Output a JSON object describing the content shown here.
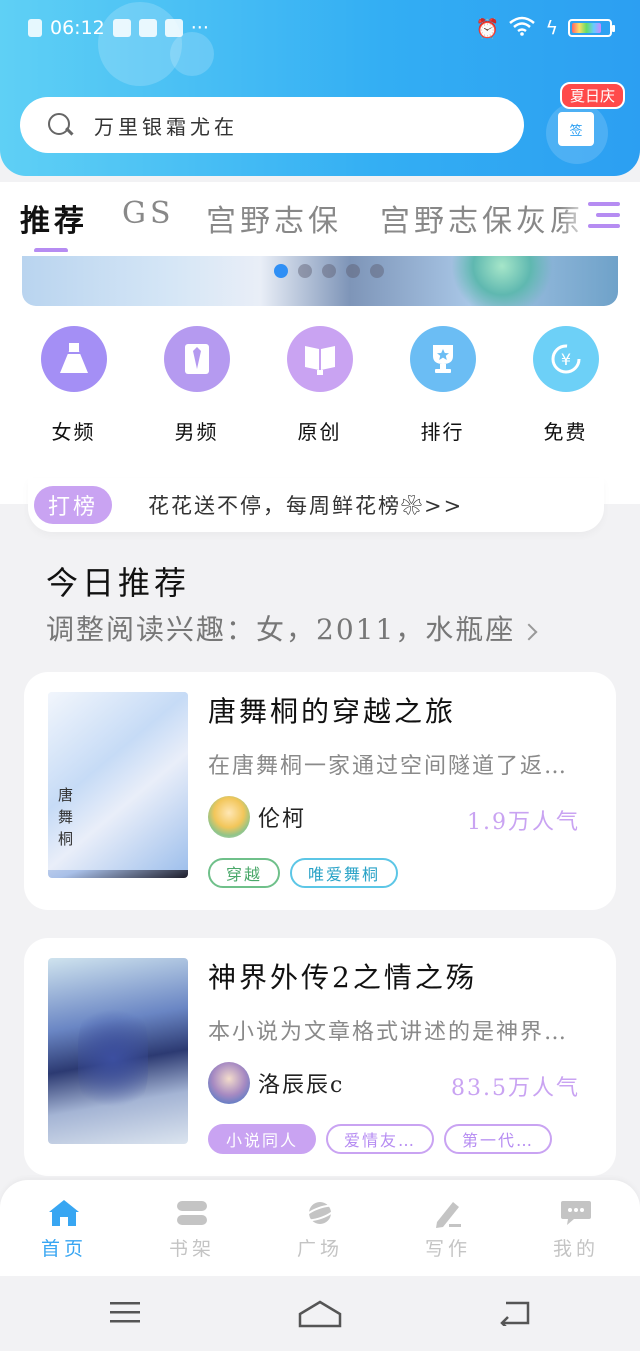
{
  "status_bar": {
    "time": "06:12",
    "colors": {
      "battery": "#ffffff"
    }
  },
  "search": {
    "placeholder": "万里银霜尤在"
  },
  "checkin": {
    "badge": "夏日庆",
    "label": "签"
  },
  "tabs": [
    {
      "label": "推荐",
      "active": true
    },
    {
      "label": "GS"
    },
    {
      "label": "宫野志保"
    },
    {
      "label": "宫野志保灰原"
    }
  ],
  "banner": {
    "active_index": 0
  },
  "categories": [
    {
      "label": "女频",
      "icon": "dress-icon"
    },
    {
      "label": "男频",
      "icon": "shirt-tie-icon"
    },
    {
      "label": "原创",
      "icon": "book-icon"
    },
    {
      "label": "排行",
      "icon": "trophy-icon"
    },
    {
      "label": "免费",
      "icon": "yen-icon"
    }
  ],
  "notice": {
    "tag": "打榜",
    "message": "花花送不停，每周鲜花榜❀>>"
  },
  "section": {
    "title": "今日推荐",
    "subtitle": "调整阅读兴趣：女，2011，水瓶座"
  },
  "books": [
    {
      "title": "唐舞桐的穿越之旅",
      "description": "在唐舞桐一家通过空间隧道了返…",
      "author": "伦柯",
      "popularity": "1.9万人气",
      "cover_title": "唐舞桐",
      "tags": [
        "穿越",
        "唯爱舞桐"
      ]
    },
    {
      "title": "神界外传2之情之殇",
      "description": "本小说为文章格式讲述的是神界…",
      "author": "洛辰辰c",
      "popularity": "83.5万人气",
      "tags": [
        "小说同人",
        "爱情友…",
        "第一代…"
      ]
    }
  ],
  "bottom_nav": [
    {
      "label": "首页",
      "icon": "home-icon",
      "active": true
    },
    {
      "label": "书架",
      "icon": "bookshelf-icon"
    },
    {
      "label": "广场",
      "icon": "planet-icon"
    },
    {
      "label": "写作",
      "icon": "pen-icon"
    },
    {
      "label": "我的",
      "icon": "chat-bubble-icon"
    }
  ],
  "colors": {
    "header_gradient_start": "#5fd0f5",
    "header_gradient_end": "#2c9ff2",
    "accent_purple": "#c9a3f2",
    "active_blue": "#38a6f2"
  }
}
